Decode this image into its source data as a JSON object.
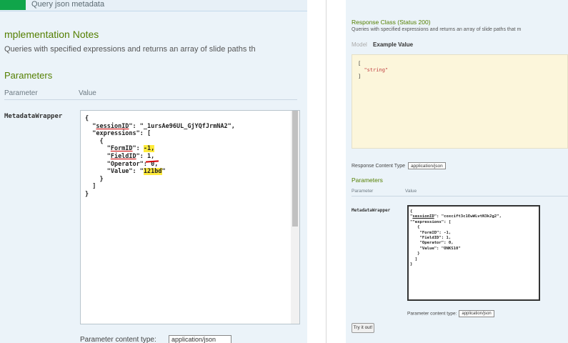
{
  "left": {
    "operation_summary": "Query json metadata",
    "implementation_notes_title": "mplementation Notes",
    "implementation_notes_desc": "Queries with specified expressions and returns an array of slide paths th",
    "parameters_title": "Parameters",
    "col_parameter": "Parameter",
    "col_value": "Value",
    "param_name": "MetadataWrapper",
    "code": {
      "l1": "{",
      "k_session": "sessionID",
      "v_session": "_1ursAe96UL_GjYQfJrmNA2",
      "k_expr": "\"expressions\": [",
      "l4": "{",
      "k_form": "FormID",
      "v_form": "-1,",
      "k_field": "FieldID",
      "v_field": "1,",
      "l_operator": "\"Operator\": 0,",
      "k_value": "\"Value\": \"",
      "v_value": "121bd",
      "l_close_obj": "}",
      "l_close_arr": "]",
      "l_close": "}"
    },
    "content_type_label": "Parameter content type:",
    "content_type_value": "application/json"
  },
  "right": {
    "response_class_title": "Response Class (Status 200)",
    "response_class_desc": "Queries with specified expressions and returns an array of slide paths that m",
    "tab_model": "Model",
    "tab_example": "Example Value",
    "example_open": "[",
    "example_string": "\"string\"",
    "example_close": "]",
    "response_content_type_label": "Response Content Type",
    "response_content_type_value": "application/json",
    "parameters_title": "Parameters",
    "col_parameter": "Parameter",
    "col_value": "Value",
    "param_name": "MetadataWrapper",
    "code": {
      "l1": "{",
      "k_session": "sessionID",
      "v_session": "\": \"coxcift3c1EwWLvtN3k2g2\",",
      "l3": "\"expressions\": [",
      "l4": "{",
      "l5": "\"FormID\": -1,",
      "l6": "\"FieldID\": 1,",
      "l7": "\"Operator\": 0,",
      "l8": "\"Value\": \"ONKS10\"",
      "l9": "}",
      "l10": "]",
      "l11": "}"
    },
    "content_type_label": "Parameter content type:",
    "content_type_value": "application/json",
    "try_button": "Try it out!"
  }
}
